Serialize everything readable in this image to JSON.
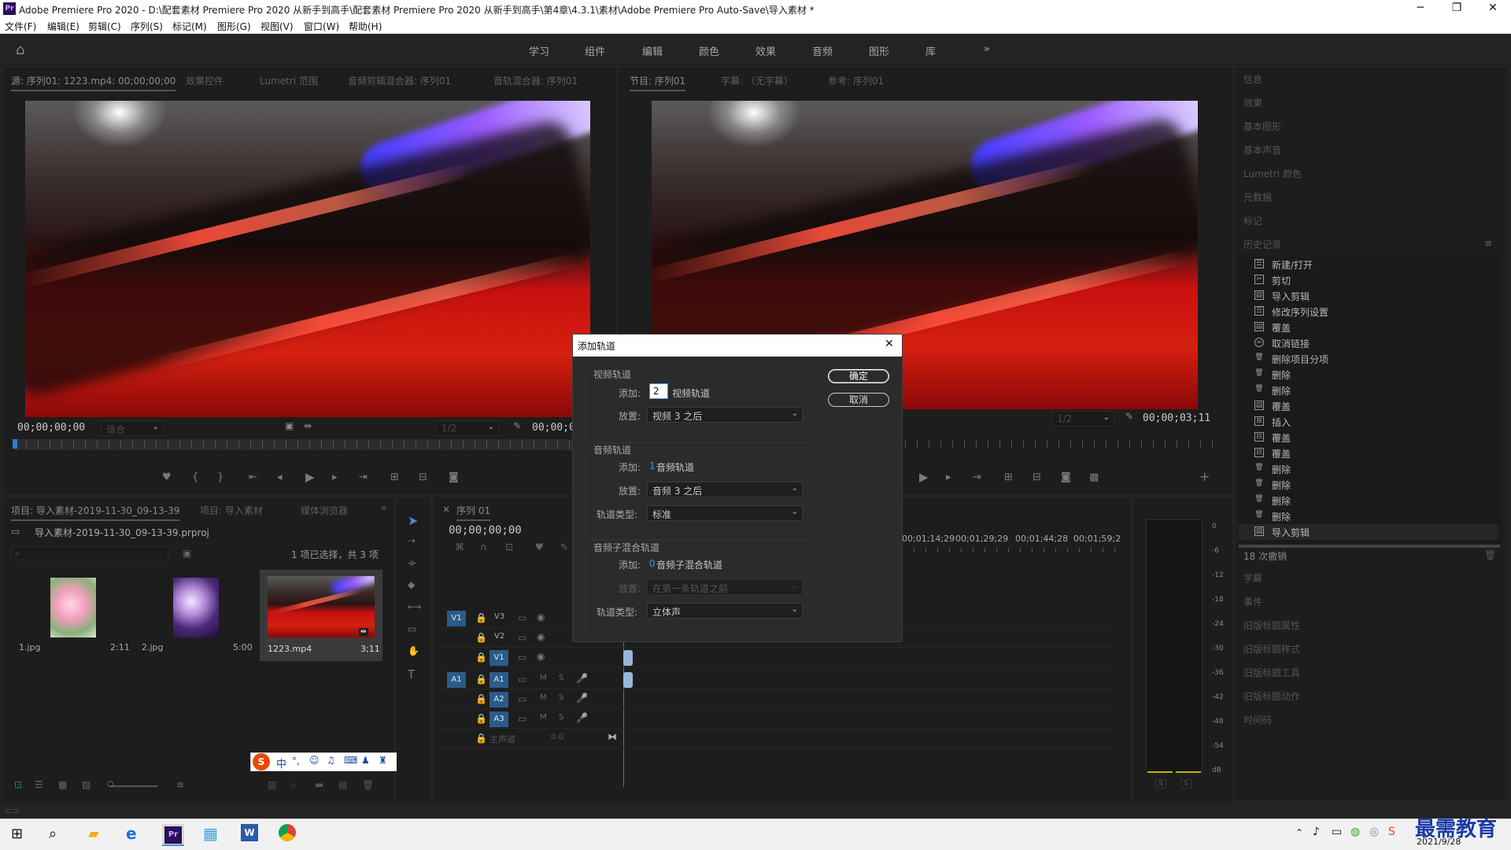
{
  "titlebar": {
    "title": "Adobe Premiere Pro 2020 - D:\\配套素材 Premiere Pro 2020 从新手到高手\\配套素材 Premiere Pro 2020 从新手到高手\\第4章\\4.3.1\\素材\\Adobe Premiere Pro Auto-Save\\导入素材 *",
    "minimize": "─",
    "maximize": "❐",
    "close": "✕"
  },
  "menu": [
    "文件(F)",
    "编辑(E)",
    "剪辑(C)",
    "序列(S)",
    "标记(M)",
    "图形(G)",
    "视图(V)",
    "窗口(W)",
    "帮助(H)"
  ],
  "workspaces": [
    "学习",
    "组件",
    "编辑",
    "颜色",
    "效果",
    "音频",
    "图形",
    "库"
  ],
  "workspaces_more": "»",
  "source_panel": {
    "tabs": [
      "源: 序列01: 1223.mp4: 00;00;00;00",
      "效果控件",
      "Lumetri 范围",
      "音频剪辑混合器: 序列01",
      "音轨混合器: 序列01"
    ],
    "timecode": "00;00;00;00",
    "fit": "适合",
    "scale": "1/2",
    "end_timecode": "00;00;0"
  },
  "program_panel": {
    "tabs": [
      "节目: 序列01",
      "字幕: （无字幕）",
      "参考: 序列01"
    ],
    "scale": "1/2",
    "timecode": "00;00;03;11"
  },
  "dialog": {
    "title": "添加轨道",
    "video": {
      "header": "视频轨道",
      "add_label": "添加:",
      "add_value": "2",
      "unit": "视频轨道",
      "place_label": "放置:",
      "place_value": "视频 3 之后"
    },
    "audio": {
      "header": "音频轨道",
      "add_label": "添加:",
      "add_value": "1",
      "unit": "音频轨道",
      "place_label": "放置:",
      "place_value": "音频 3 之后",
      "type_label": "轨道类型:",
      "type_value": "标准"
    },
    "submix": {
      "header": "音频子混合轨道",
      "add_label": "添加:",
      "add_value": "0",
      "unit": "音频子混合轨道",
      "place_label": "放置:",
      "place_value": "在第一条轨道之前",
      "type_label": "轨道类型:",
      "type_value": "立体声"
    },
    "ok": "确定",
    "cancel": "取消"
  },
  "right_panel": {
    "panels_top": [
      "信息",
      "效果",
      "基本图形",
      "基本声音",
      "Lumetri 颜色",
      "元数据",
      "标记"
    ],
    "history_title": "历史记录",
    "history": [
      "新建/打开",
      "剪切",
      "导入剪辑",
      "修改序列设置",
      "覆盖",
      "取消链接",
      "删除项目分项",
      "删除",
      "删除",
      "覆盖",
      "插入",
      "覆盖",
      "覆盖",
      "删除",
      "删除",
      "删除",
      "删除",
      "导入剪辑"
    ],
    "undo_count": "18 次撤销",
    "panels_bottom": [
      "字幕",
      "事件",
      "旧版标题属性",
      "旧版标题样式",
      "旧版标题工具",
      "旧版标题动作",
      "时间码"
    ]
  },
  "project_panel": {
    "tabs": [
      "项目: 导入素材-2019-11-30_09-13-39",
      "项目: 导入素材",
      "媒体浏览器"
    ],
    "file": "导入素材-2019-11-30_09-13-39.prproj",
    "selection": "1 项已选择，共 3 项",
    "items": [
      {
        "name": "1.jpg",
        "duration": "2:11"
      },
      {
        "name": "2.jpg",
        "duration": "5:00"
      },
      {
        "name": "1223.mp4",
        "duration": "3;11"
      }
    ]
  },
  "timeline": {
    "tab": "序列 01",
    "timecode": "00;00;00;00",
    "ruler": [
      "00;01;14;29",
      "00;01;29;29",
      "00;01;44;28",
      "00;01;59;2"
    ],
    "video_tracks": [
      "V3",
      "V2",
      "V1"
    ],
    "audio_tracks": [
      "A1",
      "A2",
      "A3"
    ],
    "master": "主声道",
    "master_value": "0.0",
    "src_v": "V1",
    "src_a": "A1",
    "m": "M",
    "s": "S"
  },
  "meter": {
    "scale": [
      "0",
      "-6",
      "-12",
      "-18",
      "-24",
      "-30",
      "-36",
      "-42",
      "-48",
      "-54",
      "dB"
    ],
    "solo": "S"
  },
  "ime": {
    "brand": "S",
    "lang": "中"
  },
  "taskbar": {
    "date": "2021/9/28",
    "watermark": "最需教育"
  },
  "colors": {
    "accent": "#2a5b8a",
    "panel": "#1d1d1d",
    "bg": "#232323"
  }
}
